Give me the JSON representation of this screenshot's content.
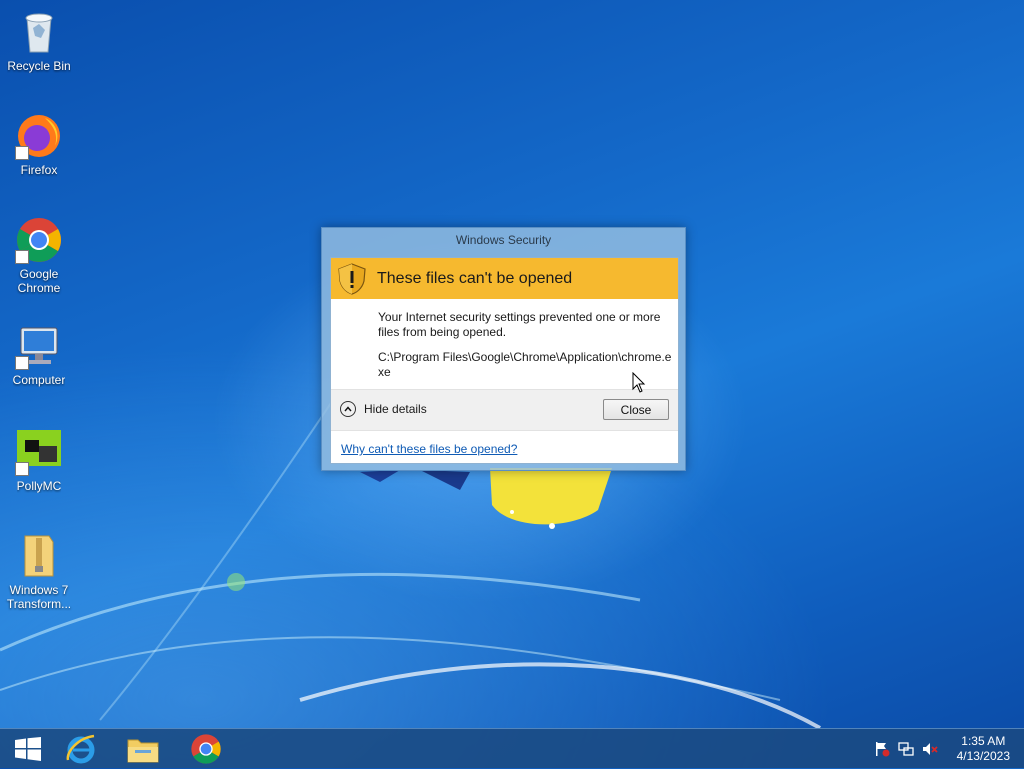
{
  "desktop": {
    "icons": [
      {
        "label": "Recycle Bin"
      },
      {
        "label": "Firefox"
      },
      {
        "label": "Google Chrome"
      },
      {
        "label": "Computer"
      },
      {
        "label": "PollyMC"
      },
      {
        "label": "Windows 7 Transform..."
      }
    ]
  },
  "dialog": {
    "window_title": "Windows Security",
    "heading": "These files can't be opened",
    "message": "Your Internet security settings prevented one or more files from being opened.",
    "file_path": "C:\\Program Files\\Google\\Chrome\\Application\\chrome.exe",
    "toggle_label": "Hide details",
    "close_label": "Close",
    "help_link": "Why can't these files be opened?"
  },
  "taskbar": {
    "pinned": [
      "start-icon",
      "internet-explorer-icon",
      "file-explorer-icon",
      "chrome-icon"
    ],
    "tray": {
      "time": "1:35 AM",
      "date": "4/13/2023"
    }
  },
  "colors": {
    "banner": "#f6b92f",
    "link": "#0f5bb5",
    "taskbar": "#1a4a82"
  }
}
